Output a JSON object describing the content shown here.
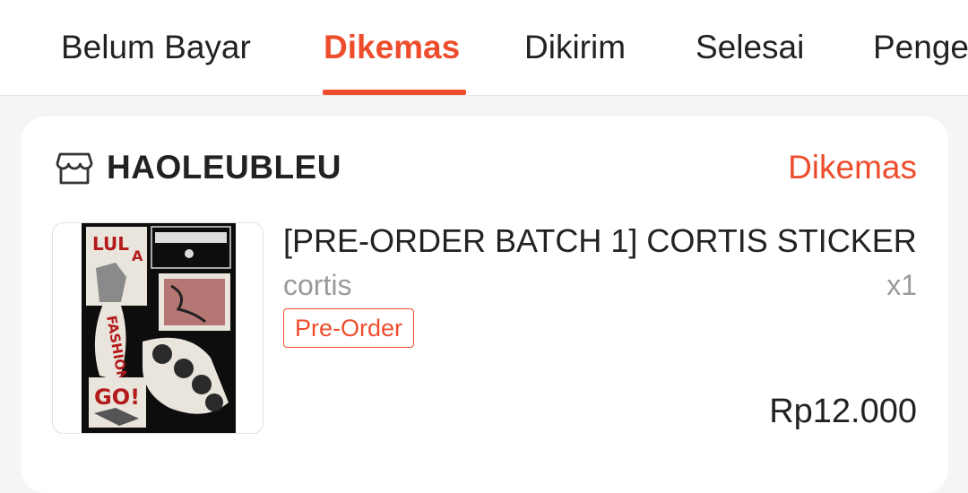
{
  "tabs": [
    {
      "label": "Belum Bayar"
    },
    {
      "label": "Dikemas"
    },
    {
      "label": "Dikirim"
    },
    {
      "label": "Selesai"
    },
    {
      "label": "Pengembalian"
    }
  ],
  "active_tab": "Dikemas",
  "order": {
    "shop_name": "HAOLEUBLEU",
    "status": "Dikemas",
    "shop_icon": "store-icon",
    "product": {
      "title": "[PRE-ORDER BATCH 1] CORTIS STICKER",
      "variant": "cortis",
      "quantity": "x1",
      "badge": "Pre-Order",
      "price": "Rp12.000",
      "thumbnail_text": {
        "sticker_a": "LUL",
        "sticker_b": "A",
        "sticker_c": "FASHION",
        "sticker_d": "GO!"
      }
    }
  },
  "colors": {
    "accent": "#ee4d2d",
    "text": "#222222",
    "muted": "#9a9a9a",
    "background": "#f5f5f5"
  }
}
